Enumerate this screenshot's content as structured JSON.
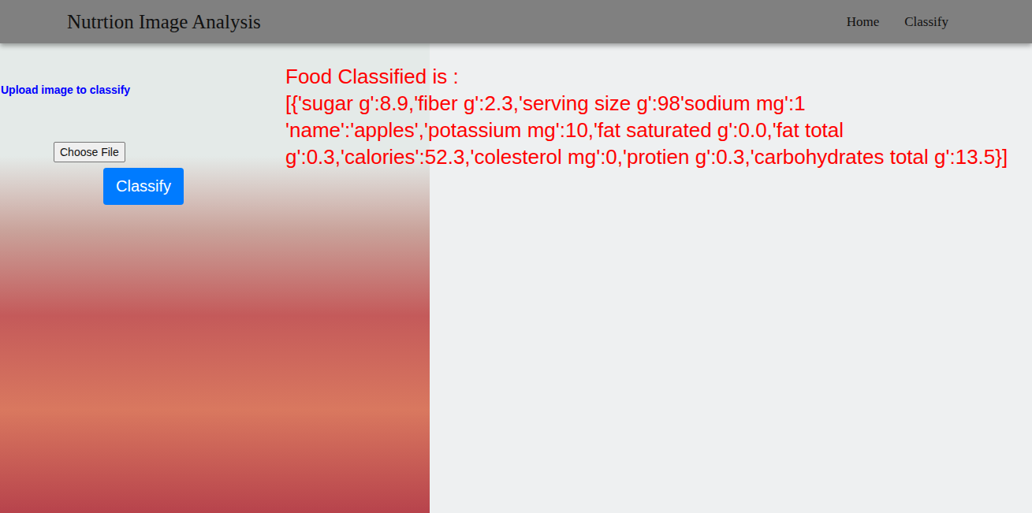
{
  "navbar": {
    "title": "Nutrtion Image Analysis",
    "links": [
      {
        "label": "Home"
      },
      {
        "label": "Classify"
      }
    ]
  },
  "upload": {
    "label": "Upload image to classify",
    "file_button": "Choose File",
    "classify_button": "Classify"
  },
  "result": {
    "heading": "Food Classified is :",
    "text": "[{'sugar g':8.9,'fiber g':2.3,'serving size g':98'sodium mg':1 'name':'apples','potassium mg':10,'fat saturated g':0.0,'fat total g':0.3,'calories':52.3,'colesterol mg':0,'protien g':0.3,'carbohydrates total g':13.5}]"
  }
}
